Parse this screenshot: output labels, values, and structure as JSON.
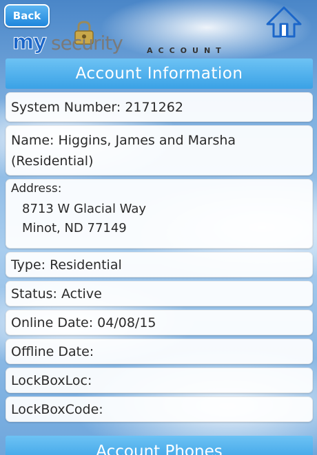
{
  "nav": {
    "back_label": "Back",
    "up_icon": "home-arrow-up-icon"
  },
  "logo": {
    "my": "my",
    "security": "security",
    "account": "ACCOUNT"
  },
  "section": {
    "title": "Account Information",
    "next_title": "Account Phones"
  },
  "fields": {
    "system_number": "System Number: 2171262",
    "name": "Name: Higgins, James and Marsha (Residential)",
    "address_label": "Address:",
    "address_line1": "8713 W Glacial Way",
    "address_line2": "Minot, ND 77149",
    "type": "Type: Residential",
    "status": "Status: Active",
    "online_date": "Online Date: 04/08/15",
    "offline_date": "Offline Date:",
    "lockbox_loc": "LockBoxLoc:",
    "lockbox_code": "LockBoxCode:"
  },
  "colors": {
    "accent": "#3aa2e6",
    "back_button": "#1f86dc",
    "logo_blue": "#1b66c9"
  }
}
